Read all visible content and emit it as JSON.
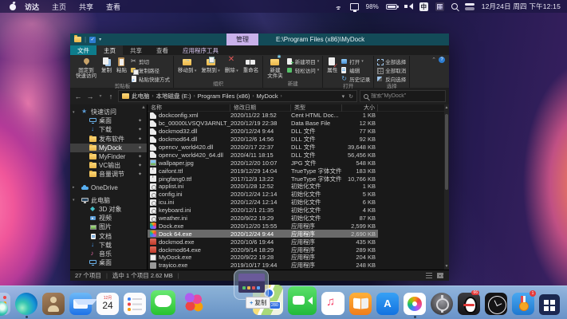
{
  "menu_bar": {
    "items": [
      "访达",
      "主页",
      "共享",
      "查看"
    ],
    "battery_percent": "98%",
    "ime_label": "中",
    "clock": "12月24日 周四 下午12:15"
  },
  "window": {
    "title": "E:\\Program Files (x86)\\MyDock",
    "context_tab": "管理",
    "ribbon_tabs": [
      "文件",
      "主页",
      "共享",
      "查看",
      "应用程序工具"
    ],
    "ribbon": {
      "groups": [
        {
          "label": "剪贴板",
          "large": [
            {
              "icon": "pin",
              "lines": [
                "固定到",
                "快速访问"
              ]
            },
            {
              "icon": "copy",
              "lines": [
                "复制"
              ]
            },
            {
              "icon": "paste",
              "lines": [
                "粘贴"
              ]
            }
          ],
          "small": [
            {
              "icon": "cut",
              "label": "剪切"
            },
            {
              "icon": "path",
              "label": "复制路径"
            },
            {
              "icon": "shortcut",
              "label": "粘贴快捷方式"
            }
          ]
        },
        {
          "label": "组织",
          "large": [
            {
              "icon": "move-to",
              "lines": [
                "移动到"
              ],
              "caret": true
            },
            {
              "icon": "copy-to",
              "lines": [
                "复制到"
              ],
              "caret": true
            },
            {
              "icon": "delete",
              "lines": [
                "删除"
              ],
              "caret": true
            },
            {
              "icon": "rename",
              "lines": [
                "重命名"
              ]
            }
          ],
          "small": []
        },
        {
          "label": "新建",
          "large": [
            {
              "icon": "new-folder",
              "lines": [
                "新建",
                "文件夹"
              ]
            }
          ],
          "small": [
            {
              "icon": "new-item",
              "label": "新建项目",
              "caret": true
            },
            {
              "icon": "easy-access",
              "label": "轻松访问",
              "caret": true
            }
          ]
        },
        {
          "label": "打开",
          "large": [
            {
              "icon": "properties",
              "lines": [
                "属性"
              ]
            }
          ],
          "small": [
            {
              "icon": "open",
              "label": "打开",
              "caret": true
            },
            {
              "icon": "edit",
              "label": "编辑"
            },
            {
              "icon": "history",
              "label": "历史记录"
            }
          ]
        },
        {
          "label": "选择",
          "large": [],
          "small": [
            {
              "icon": "select-all",
              "label": "全部选择"
            },
            {
              "icon": "select-none",
              "label": "全部取消"
            },
            {
              "icon": "invert",
              "label": "反向选择"
            }
          ]
        }
      ]
    },
    "address": {
      "crumbs": [
        "此电脑",
        "本地磁盘 (E:)",
        "Program Files (x86)",
        "MyDock"
      ],
      "search_placeholder": "搜索\"MyDock\""
    },
    "sidebar": {
      "sections": [
        {
          "label": "快速访问",
          "icon": "star",
          "chev": "▾",
          "items": [
            {
              "label": "桌面",
              "icon": "desktop",
              "pin": true
            },
            {
              "label": "下载",
              "icon": "down",
              "pin": true
            },
            {
              "label": "发布软件",
              "icon": "folder",
              "pin": true
            },
            {
              "label": "MyDock",
              "icon": "folder",
              "pin": true,
              "selected": true
            },
            {
              "label": "MyFinder",
              "icon": "folder",
              "pin": true
            },
            {
              "label": "VC输出",
              "icon": "folder",
              "pin": true
            },
            {
              "label": "音量调节",
              "icon": "folder",
              "pin": true
            }
          ]
        },
        {
          "label": "OneDrive",
          "icon": "cloud",
          "chev": "▸",
          "items": []
        },
        {
          "label": "此电脑",
          "icon": "pc",
          "chev": "▾",
          "items": [
            {
              "label": "3D 对象",
              "icon": "cube"
            },
            {
              "label": "视频",
              "icon": "video"
            },
            {
              "label": "图片",
              "icon": "pic"
            },
            {
              "label": "文档",
              "icon": "doc"
            },
            {
              "label": "下载",
              "icon": "down"
            },
            {
              "label": "音乐",
              "icon": "music"
            },
            {
              "label": "桌面",
              "icon": "desktop"
            }
          ]
        }
      ]
    },
    "files": {
      "columns": [
        "名称",
        "修改日期",
        "类型",
        "大小"
      ],
      "rows": [
        {
          "name": "dockconfig.xml",
          "icon": "page",
          "date": "2020/11/22 18:52",
          "type": "Cent HTML Doc...",
          "size": "1 KB"
        },
        {
          "name": "bc_00000LVSQV3ARNLT_05.db",
          "icon": "page",
          "date": "2020/12/19 22:38",
          "type": "Data Base File",
          "size": "12 KB"
        },
        {
          "name": "dockmod32.dll",
          "icon": "page",
          "date": "2020/12/24 9:44",
          "type": "DLL 文件",
          "size": "77 KB"
        },
        {
          "name": "dockmod64.dll",
          "icon": "page",
          "date": "2020/12/6 14:56",
          "type": "DLL 文件",
          "size": "92 KB"
        },
        {
          "name": "opencv_world420.dll",
          "icon": "page",
          "date": "2020/2/17 22:37",
          "type": "DLL 文件",
          "size": "39,648 KB"
        },
        {
          "name": "opencv_world420_64.dll",
          "icon": "page",
          "date": "2020/4/11 18:15",
          "type": "DLL 文件",
          "size": "56,456 KB"
        },
        {
          "name": "wallpaper.jpg",
          "icon": "image",
          "date": "2020/12/20 10:07",
          "type": "JPG 文件",
          "size": "548 KB"
        },
        {
          "name": "caifont.ttf",
          "icon": "font",
          "date": "2019/12/29 14:04",
          "type": "TrueType 字体文件",
          "size": "183 KB"
        },
        {
          "name": "pingfang0.ttf",
          "icon": "font",
          "date": "2017/12/3 13:22",
          "type": "TrueType 字体文件",
          "size": "10,766 KB"
        },
        {
          "name": "applist.ini",
          "icon": "ini",
          "date": "2020/1/28 12:52",
          "type": "初始化文件",
          "size": "1 KB"
        },
        {
          "name": "config.ini",
          "icon": "ini",
          "date": "2020/12/24 12:14",
          "type": "初始化文件",
          "size": "5 KB"
        },
        {
          "name": "icu.ini",
          "icon": "ini",
          "date": "2020/12/24 12:14",
          "type": "初始化文件",
          "size": "6 KB"
        },
        {
          "name": "keyboard.ini",
          "icon": "ini",
          "date": "2020/12/1 21:35",
          "type": "初始化文件",
          "size": "4 KB"
        },
        {
          "name": "weather.ini",
          "icon": "ini",
          "date": "2020/9/22 19:29",
          "type": "初始化文件",
          "size": "87 KB"
        },
        {
          "name": "Dock.exe",
          "icon": "app-color",
          "date": "2020/12/20 15:55",
          "type": "应用程序",
          "size": "2,599 KB"
        },
        {
          "name": "Dock 64.exe",
          "icon": "app-color",
          "date": "2020/12/24 9:44",
          "type": "应用程序",
          "size": "2,690 KB",
          "selected": true
        },
        {
          "name": "dockmod.exe",
          "icon": "app-red",
          "date": "2020/10/6 19:44",
          "type": "应用程序",
          "size": "435 KB"
        },
        {
          "name": "dockmod64.exe",
          "icon": "app-red",
          "date": "2020/9/14 18:29",
          "type": "应用程序",
          "size": "289 KB"
        },
        {
          "name": "MyDock.exe",
          "icon": "app-white",
          "date": "2020/9/22 19:28",
          "type": "应用程序",
          "size": "204 KB"
        },
        {
          "name": "trayico.exe",
          "icon": "app-gray",
          "date": "2019/10/17 19:44",
          "type": "应用程序",
          "size": "248 KB"
        }
      ]
    },
    "status": {
      "items_count": "27 个项目",
      "selection": "选中 1 个项目 2.62 MB"
    }
  },
  "dock": {
    "apps": [
      {
        "id": "launchpad"
      },
      {
        "id": "edge",
        "running": true
      },
      {
        "id": "contacts"
      },
      {
        "id": "mail"
      },
      {
        "id": "calendar",
        "month": "12月",
        "day": "24"
      },
      {
        "id": "reminders"
      },
      {
        "id": "messages"
      },
      {
        "id": "media"
      },
      {
        "id": "maps",
        "badge": "280"
      },
      {
        "id": "facetime"
      },
      {
        "id": "music"
      },
      {
        "id": "books"
      },
      {
        "id": "appstore"
      },
      {
        "id": "photos",
        "running": true
      },
      {
        "id": "settings"
      },
      {
        "id": "qq",
        "badge": "66"
      },
      {
        "id": "clock"
      },
      {
        "id": "rewards",
        "badge": "1"
      },
      {
        "id": "windows"
      }
    ],
    "drag_hint": {
      "plus": "+",
      "label": "复制"
    }
  }
}
